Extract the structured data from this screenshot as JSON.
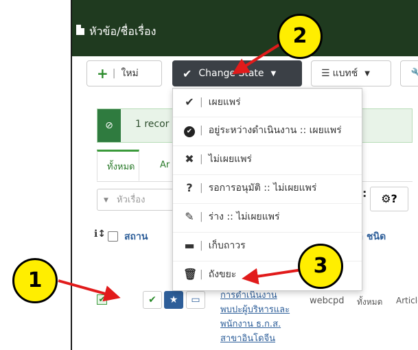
{
  "app": {
    "title": "หัวข้อ/ชื่อเรื่อง"
  },
  "toolbar": {
    "new_label": "ใหม่",
    "change_state_label": "Change State",
    "batch_label": "แบทช์"
  },
  "alert": {
    "text": "1 recor"
  },
  "tabs": {
    "all": "ทั้งหมด",
    "other": "Ar"
  },
  "search": {
    "placeholder": "หัวเรื่อง"
  },
  "table": {
    "headers": {
      "status": "สถาน",
      "lang_type": "ภาษา ชนิด"
    },
    "row": {
      "title_lines": [
        "การดำเนินงาน",
        "พบปะผู้บริหารและ",
        "พนักงาน ธ.ก.ส.",
        "สาขาอินโดจีน"
      ],
      "author": "webcpd",
      "language": "ทั้งหมด",
      "type": "Article"
    }
  },
  "menu": {
    "items": [
      {
        "icon": "check-icon",
        "glyph": "✔",
        "label": "เผยแพร่"
      },
      {
        "icon": "check-circle-icon",
        "glyph": "✔",
        "label": "อยู่ระหว่างดำเนินงาน :: เผยแพร่"
      },
      {
        "icon": "times-icon",
        "glyph": "✖",
        "label": "ไม่เผยแพร่"
      },
      {
        "icon": "question-icon",
        "glyph": "?",
        "label": "รอการอนุมัติ :: ไม่เผยแพร่"
      },
      {
        "icon": "edit-icon",
        "glyph": "✎",
        "label": "ร่าง :: ไม่เผยแพร่"
      },
      {
        "icon": "archive-icon",
        "glyph": "▬",
        "label": "เก็บถาวร"
      },
      {
        "icon": "trash-icon",
        "glyph": "🗑",
        "label": "ถังขยะ"
      }
    ]
  },
  "annotations": {
    "one": "1",
    "two": "2",
    "three": "3"
  },
  "colors": {
    "header_bg": "#1f3a1f",
    "accent": "#2d5e99",
    "annotation": "#ffee00",
    "arrow": "#e11b1b"
  }
}
